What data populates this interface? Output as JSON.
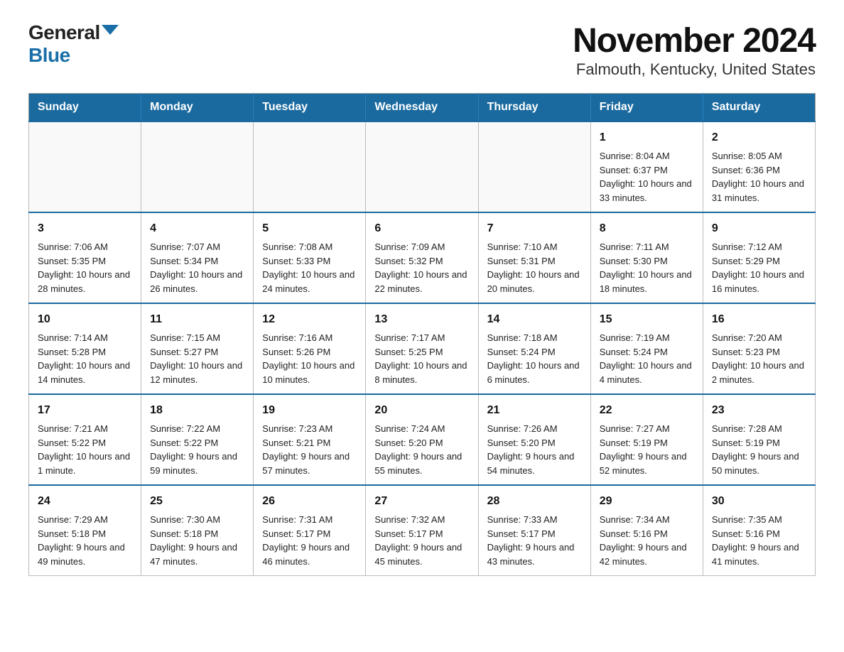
{
  "logo": {
    "general": "General",
    "blue": "Blue"
  },
  "title": "November 2024",
  "subtitle": "Falmouth, Kentucky, United States",
  "days_of_week": [
    "Sunday",
    "Monday",
    "Tuesday",
    "Wednesday",
    "Thursday",
    "Friday",
    "Saturday"
  ],
  "weeks": [
    [
      {
        "day": "",
        "info": ""
      },
      {
        "day": "",
        "info": ""
      },
      {
        "day": "",
        "info": ""
      },
      {
        "day": "",
        "info": ""
      },
      {
        "day": "",
        "info": ""
      },
      {
        "day": "1",
        "info": "Sunrise: 8:04 AM\nSunset: 6:37 PM\nDaylight: 10 hours and 33 minutes."
      },
      {
        "day": "2",
        "info": "Sunrise: 8:05 AM\nSunset: 6:36 PM\nDaylight: 10 hours and 31 minutes."
      }
    ],
    [
      {
        "day": "3",
        "info": "Sunrise: 7:06 AM\nSunset: 5:35 PM\nDaylight: 10 hours and 28 minutes."
      },
      {
        "day": "4",
        "info": "Sunrise: 7:07 AM\nSunset: 5:34 PM\nDaylight: 10 hours and 26 minutes."
      },
      {
        "day": "5",
        "info": "Sunrise: 7:08 AM\nSunset: 5:33 PM\nDaylight: 10 hours and 24 minutes."
      },
      {
        "day": "6",
        "info": "Sunrise: 7:09 AM\nSunset: 5:32 PM\nDaylight: 10 hours and 22 minutes."
      },
      {
        "day": "7",
        "info": "Sunrise: 7:10 AM\nSunset: 5:31 PM\nDaylight: 10 hours and 20 minutes."
      },
      {
        "day": "8",
        "info": "Sunrise: 7:11 AM\nSunset: 5:30 PM\nDaylight: 10 hours and 18 minutes."
      },
      {
        "day": "9",
        "info": "Sunrise: 7:12 AM\nSunset: 5:29 PM\nDaylight: 10 hours and 16 minutes."
      }
    ],
    [
      {
        "day": "10",
        "info": "Sunrise: 7:14 AM\nSunset: 5:28 PM\nDaylight: 10 hours and 14 minutes."
      },
      {
        "day": "11",
        "info": "Sunrise: 7:15 AM\nSunset: 5:27 PM\nDaylight: 10 hours and 12 minutes."
      },
      {
        "day": "12",
        "info": "Sunrise: 7:16 AM\nSunset: 5:26 PM\nDaylight: 10 hours and 10 minutes."
      },
      {
        "day": "13",
        "info": "Sunrise: 7:17 AM\nSunset: 5:25 PM\nDaylight: 10 hours and 8 minutes."
      },
      {
        "day": "14",
        "info": "Sunrise: 7:18 AM\nSunset: 5:24 PM\nDaylight: 10 hours and 6 minutes."
      },
      {
        "day": "15",
        "info": "Sunrise: 7:19 AM\nSunset: 5:24 PM\nDaylight: 10 hours and 4 minutes."
      },
      {
        "day": "16",
        "info": "Sunrise: 7:20 AM\nSunset: 5:23 PM\nDaylight: 10 hours and 2 minutes."
      }
    ],
    [
      {
        "day": "17",
        "info": "Sunrise: 7:21 AM\nSunset: 5:22 PM\nDaylight: 10 hours and 1 minute."
      },
      {
        "day": "18",
        "info": "Sunrise: 7:22 AM\nSunset: 5:22 PM\nDaylight: 9 hours and 59 minutes."
      },
      {
        "day": "19",
        "info": "Sunrise: 7:23 AM\nSunset: 5:21 PM\nDaylight: 9 hours and 57 minutes."
      },
      {
        "day": "20",
        "info": "Sunrise: 7:24 AM\nSunset: 5:20 PM\nDaylight: 9 hours and 55 minutes."
      },
      {
        "day": "21",
        "info": "Sunrise: 7:26 AM\nSunset: 5:20 PM\nDaylight: 9 hours and 54 minutes."
      },
      {
        "day": "22",
        "info": "Sunrise: 7:27 AM\nSunset: 5:19 PM\nDaylight: 9 hours and 52 minutes."
      },
      {
        "day": "23",
        "info": "Sunrise: 7:28 AM\nSunset: 5:19 PM\nDaylight: 9 hours and 50 minutes."
      }
    ],
    [
      {
        "day": "24",
        "info": "Sunrise: 7:29 AM\nSunset: 5:18 PM\nDaylight: 9 hours and 49 minutes."
      },
      {
        "day": "25",
        "info": "Sunrise: 7:30 AM\nSunset: 5:18 PM\nDaylight: 9 hours and 47 minutes."
      },
      {
        "day": "26",
        "info": "Sunrise: 7:31 AM\nSunset: 5:17 PM\nDaylight: 9 hours and 46 minutes."
      },
      {
        "day": "27",
        "info": "Sunrise: 7:32 AM\nSunset: 5:17 PM\nDaylight: 9 hours and 45 minutes."
      },
      {
        "day": "28",
        "info": "Sunrise: 7:33 AM\nSunset: 5:17 PM\nDaylight: 9 hours and 43 minutes."
      },
      {
        "day": "29",
        "info": "Sunrise: 7:34 AM\nSunset: 5:16 PM\nDaylight: 9 hours and 42 minutes."
      },
      {
        "day": "30",
        "info": "Sunrise: 7:35 AM\nSunset: 5:16 PM\nDaylight: 9 hours and 41 minutes."
      }
    ]
  ]
}
